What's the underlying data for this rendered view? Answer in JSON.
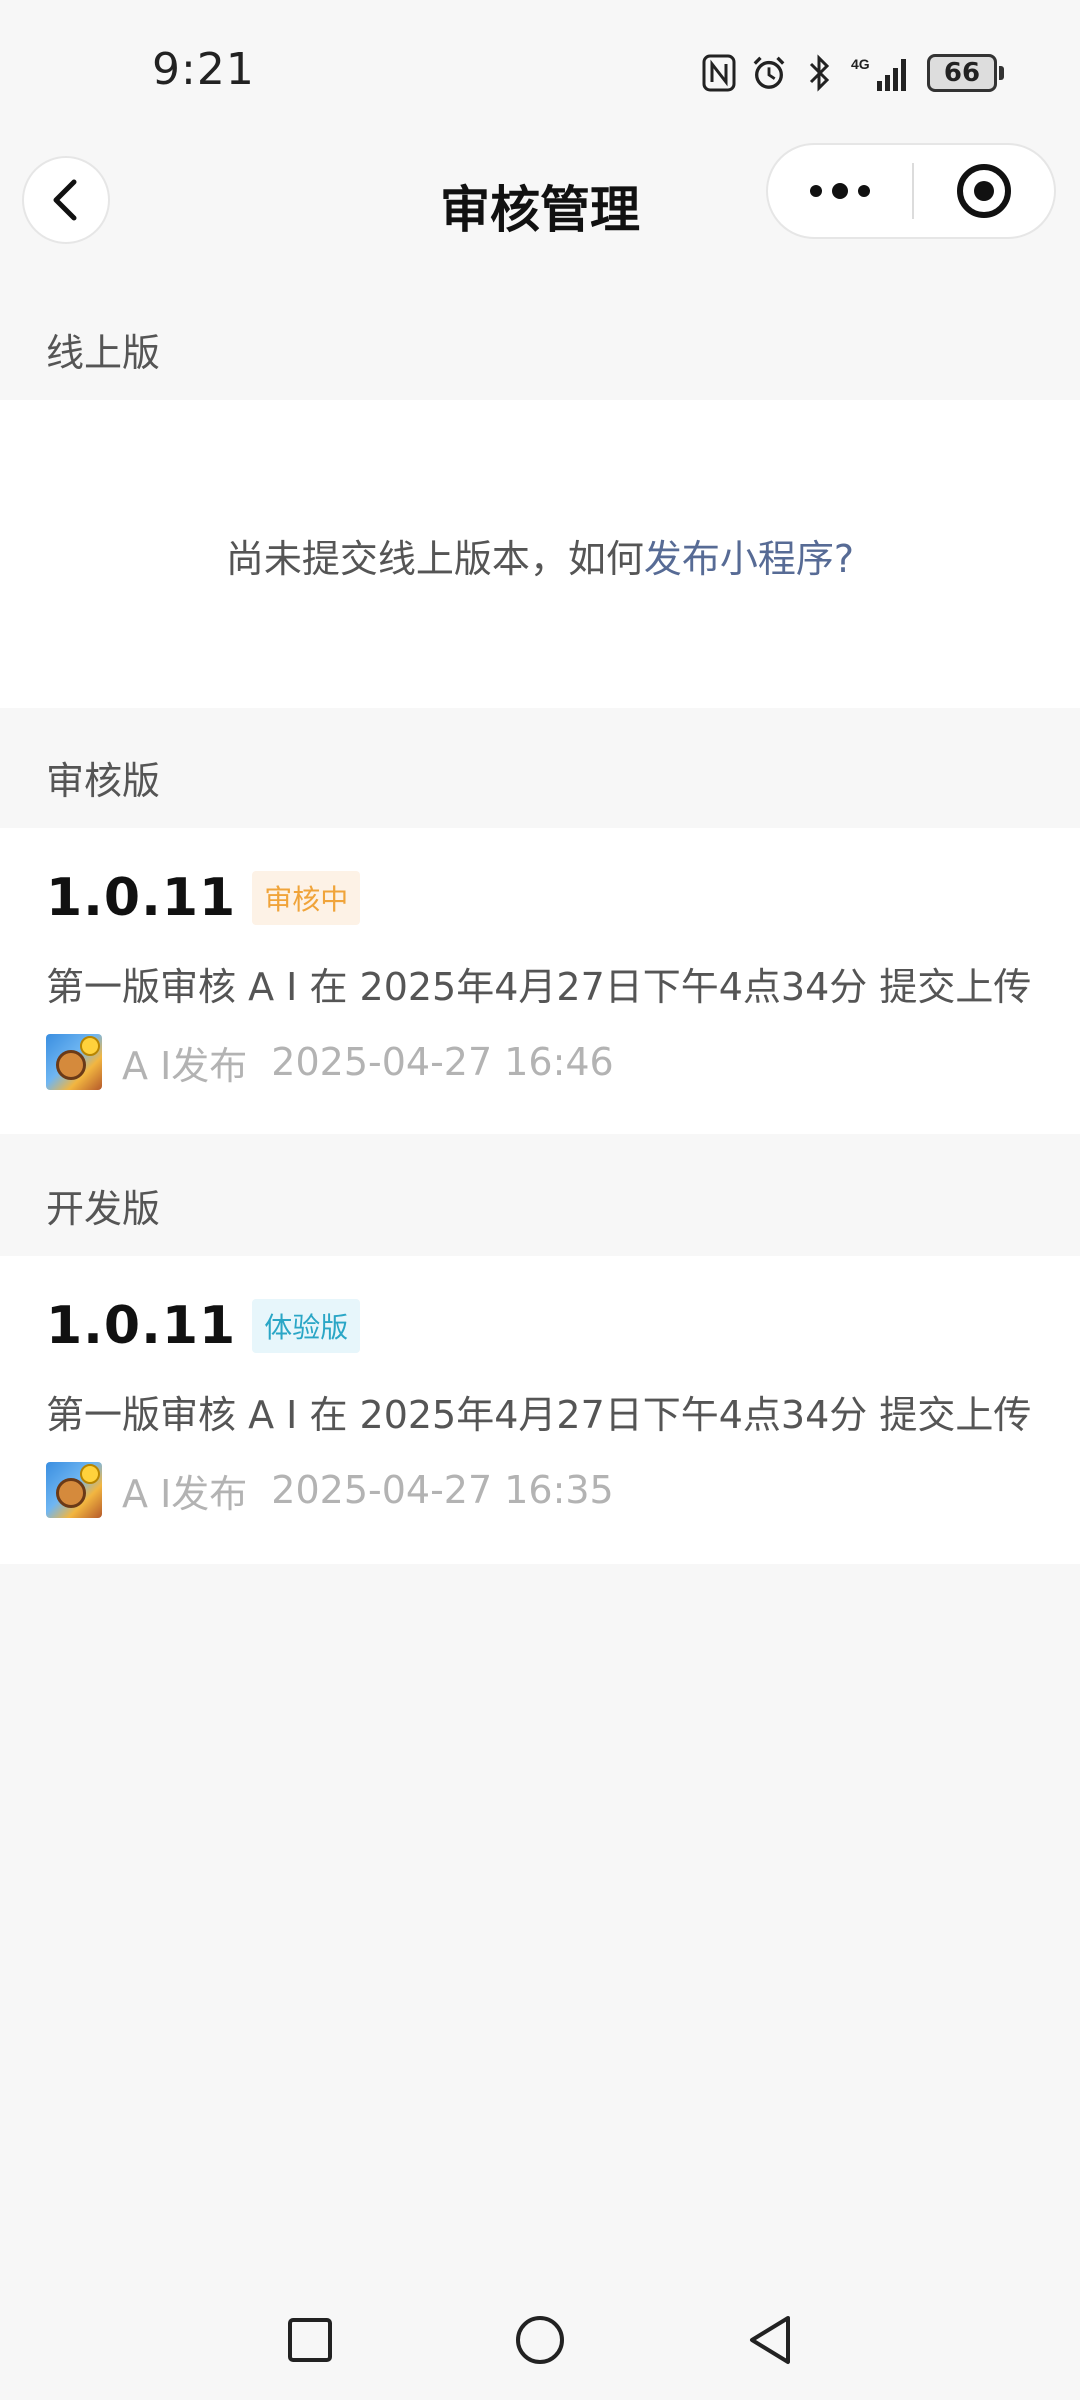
{
  "status_bar": {
    "time": "9:21",
    "network": "4G",
    "battery": "66",
    "icons": [
      "nfc-icon",
      "alarm-icon",
      "bluetooth-icon",
      "signal-icon",
      "battery-icon"
    ]
  },
  "nav": {
    "title": "审核管理",
    "back_icon": "chevron-left-icon",
    "more_icon": "more-dots-icon",
    "close_icon": "target-close-icon"
  },
  "online": {
    "header": "线上版",
    "empty_prefix": "尚未提交线上版本，如何",
    "empty_link": "发布小程序?"
  },
  "review": {
    "header": "审核版",
    "version": "1.0.11",
    "badge": "审核中",
    "description": "第一版审核 A I 在 2025年4月27日下午4点34分 提交上传",
    "author": "A I发布",
    "time": "2025-04-27 16:46"
  },
  "dev": {
    "header": "开发版",
    "version": "1.0.11",
    "badge": "体验版",
    "description": "第一版审核 A I 在 2025年4月27日下午4点34分 提交上传",
    "author": "A I发布",
    "time": "2025-04-27 16:35"
  },
  "colors": {
    "background": "#f7f7f7",
    "link": "#576b95",
    "review_badge": "#f0a43a",
    "trial_badge": "#2aa6c6"
  }
}
